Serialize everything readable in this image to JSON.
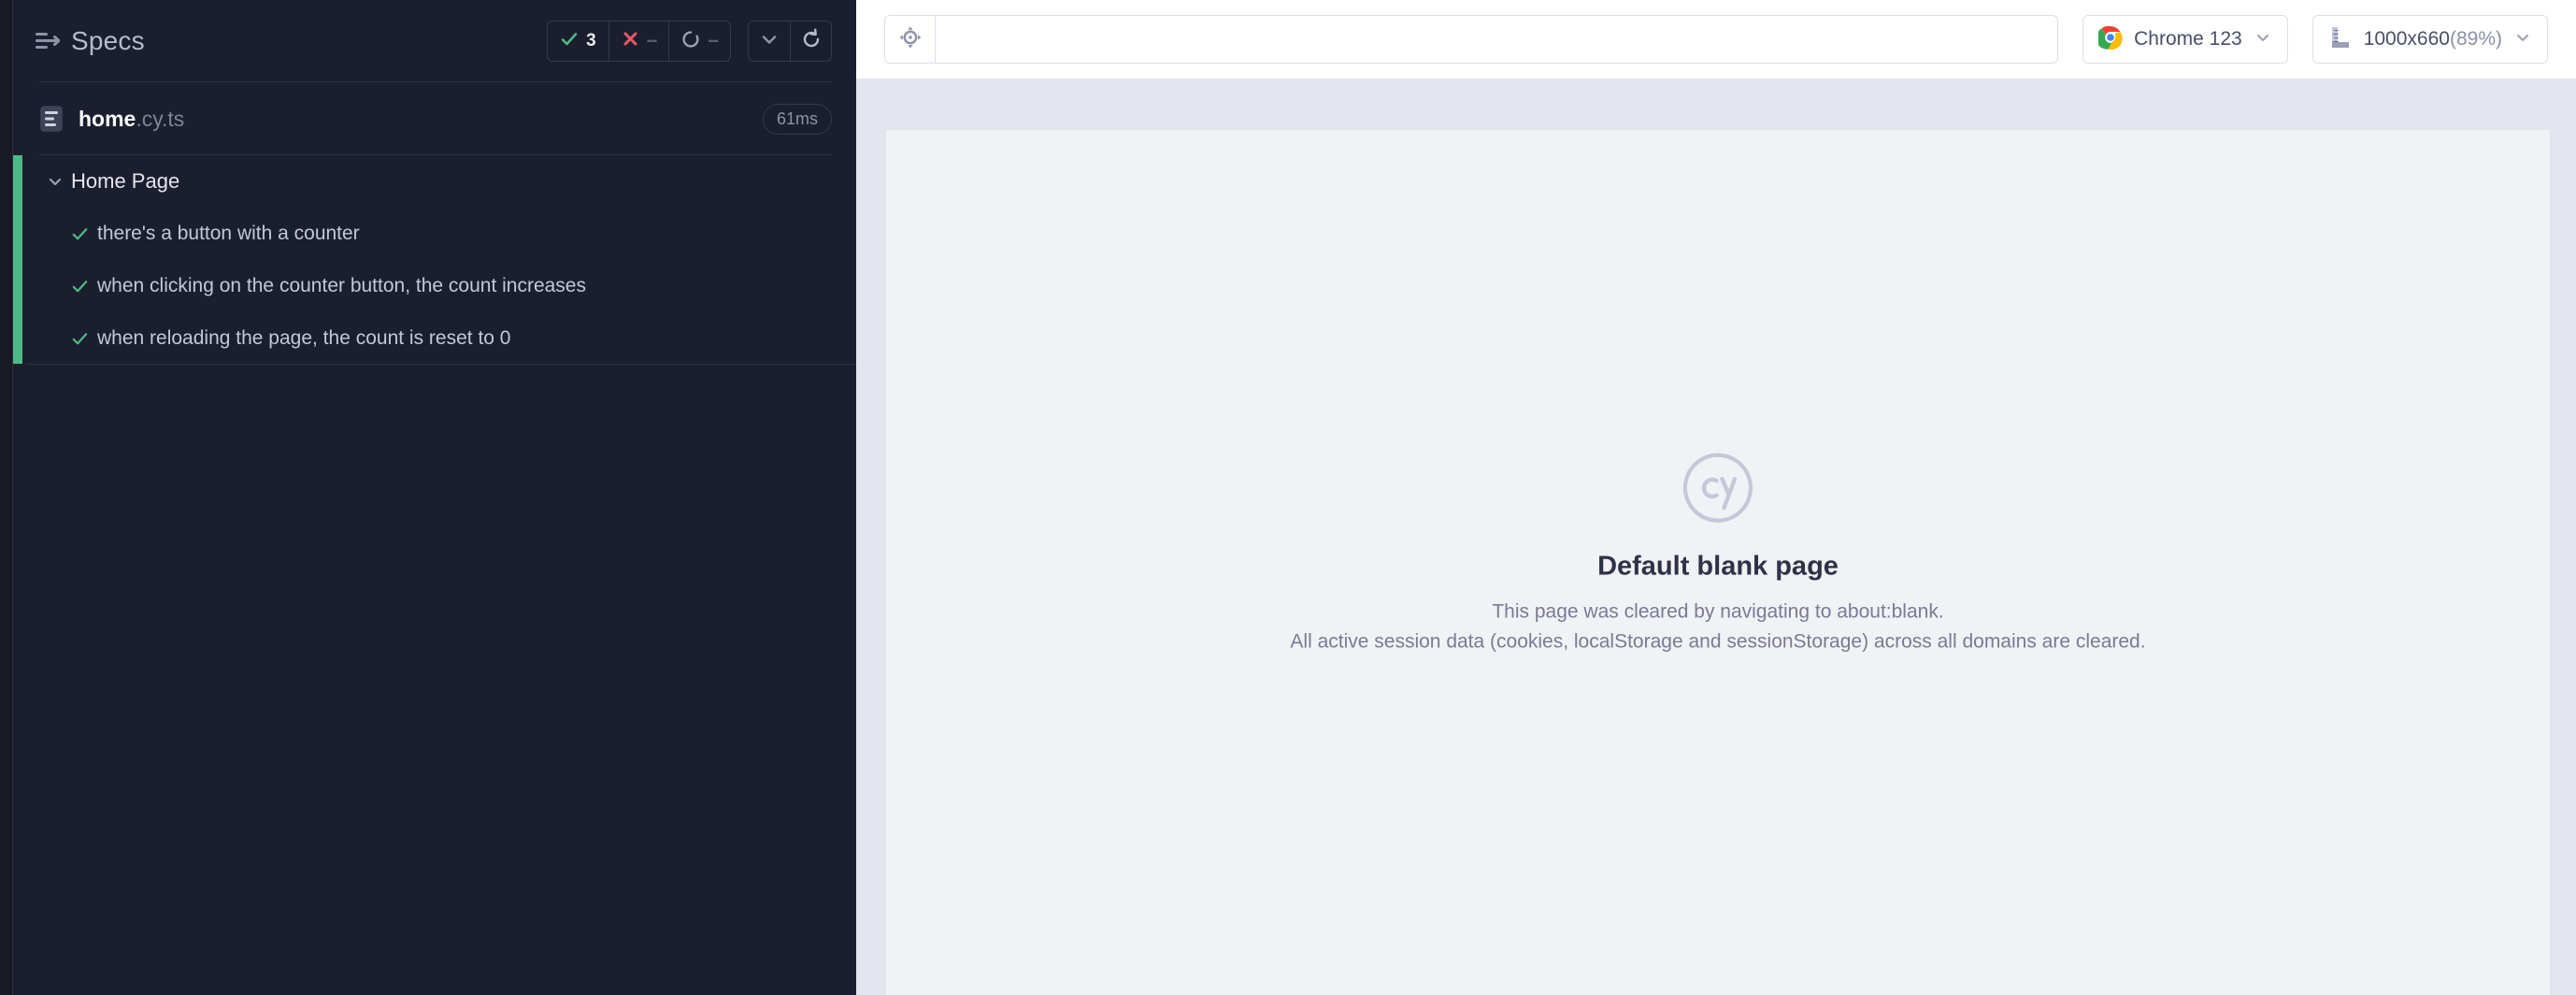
{
  "specs_panel": {
    "toggle_icon": "panel-collapse-icon",
    "title": "Specs",
    "stats": [
      {
        "key": "passed",
        "icon": "check-icon",
        "value": "3",
        "color": "#4fb884"
      },
      {
        "key": "failed",
        "icon": "x-icon",
        "value": "--",
        "color": "#e45c6a"
      },
      {
        "key": "pending",
        "icon": "circle-icon",
        "value": "--",
        "color": "#9aa0b5"
      }
    ],
    "controls": [
      {
        "name": "collapse-all-button",
        "icon": "chevron-down-icon"
      },
      {
        "name": "rerun-button",
        "icon": "refresh-icon"
      }
    ],
    "spec_file": {
      "icon": "spec-file-icon",
      "name": "home",
      "extension": ".cy.ts",
      "duration": "61ms"
    },
    "suite": {
      "name": "Home Page",
      "accent_color": "#4fb884",
      "expanded": true,
      "tests": [
        {
          "status": "passed",
          "name": "there's a button with a counter"
        },
        {
          "status": "passed",
          "name": "when clicking on the counter button, the count increases"
        },
        {
          "status": "passed",
          "name": "when reloading the page, the count is reset to 0"
        }
      ]
    }
  },
  "runner": {
    "selector_playground": {
      "icon": "crosshair-icon"
    },
    "url_bar": {
      "value": "",
      "placeholder": ""
    },
    "browser_selector": {
      "icon": "chrome-icon",
      "label": "Chrome 123",
      "chevron": "chevron-down-icon"
    },
    "viewport_selector": {
      "icon": "ruler-icon",
      "size": "1000x660",
      "scale": "(89%)",
      "chevron": "chevron-down-icon"
    },
    "aut": {
      "logo": "cypress-cy-logo",
      "title": "Default blank page",
      "line1": "This page was cleared by navigating to about:blank.",
      "line2": "All active session data (cookies, localStorage and sessionStorage) across all domains are cleared."
    }
  }
}
